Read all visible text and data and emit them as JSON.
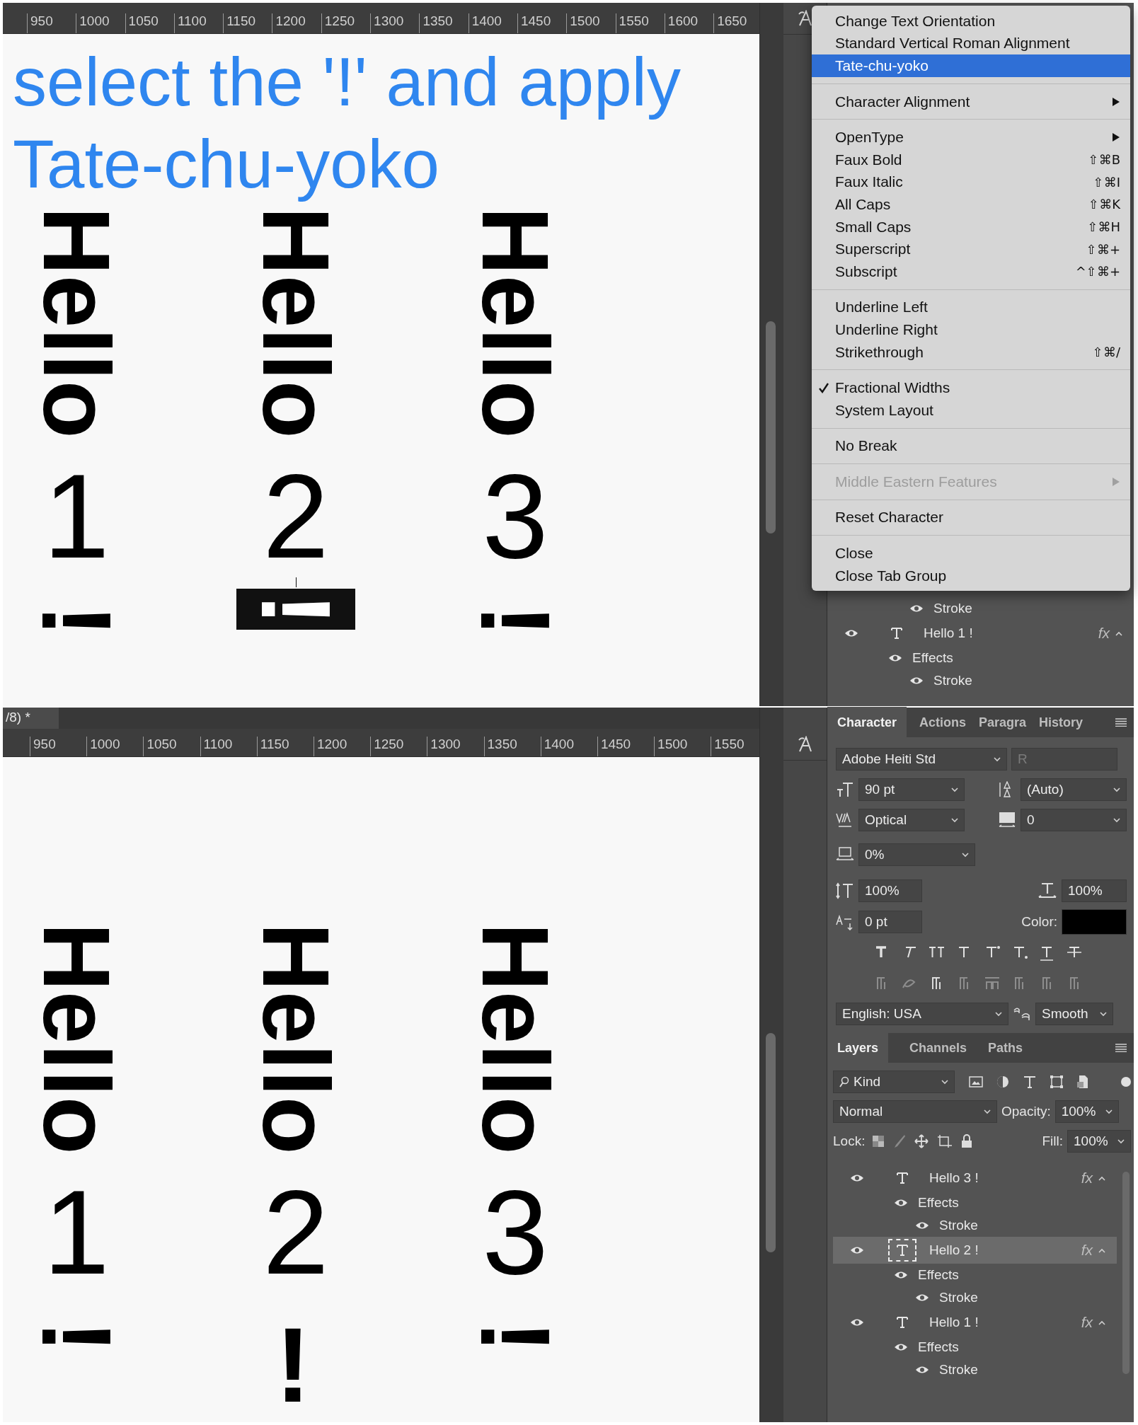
{
  "top_document": {
    "ruler_labels": [
      "950",
      "1000",
      "1050",
      "1100",
      "1150",
      "1200",
      "1250",
      "1300",
      "1350",
      "1400",
      "1450",
      "1500",
      "1550",
      "1600",
      "1650"
    ],
    "annotation": [
      "select the '!' and apply",
      "Tate-chu-yoko"
    ],
    "columns": [
      {
        "word": "Hello",
        "number": "1",
        "mark": "!",
        "mark_upright": false,
        "selected": false
      },
      {
        "word": "Hello",
        "number": "2",
        "mark": "!",
        "mark_upright": false,
        "selected": true
      },
      {
        "word": "Hello",
        "number": "3",
        "mark": "!",
        "mark_upright": false,
        "selected": false
      }
    ]
  },
  "top_panel": {
    "layers": [
      {
        "kind": "stroke",
        "name": "Stroke",
        "selected": false
      },
      {
        "kind": "layer",
        "name": "Hello 1 !",
        "fx": "fx",
        "selected": false,
        "children": [
          {
            "kind": "effects",
            "name": "Effects",
            "selected": false,
            "children": [
              {
                "kind": "stroke",
                "name": "Stroke",
                "selected": false
              }
            ]
          }
        ]
      }
    ]
  },
  "menu": {
    "groups": [
      [
        {
          "label": "Change Text Orientation",
          "submenu": false,
          "checked": false,
          "disabled": false,
          "selected": false
        },
        {
          "label": "Standard Vertical Roman Alignment",
          "submenu": false,
          "checked": false,
          "disabled": false,
          "selected": false
        },
        {
          "label": "Tate-chu-yoko",
          "submenu": false,
          "checked": false,
          "disabled": false,
          "selected": true
        }
      ],
      [
        {
          "label": "Character Alignment",
          "submenu": true,
          "checked": false,
          "disabled": false,
          "selected": false
        }
      ],
      [
        {
          "label": "OpenType",
          "submenu": true,
          "checked": false,
          "disabled": false,
          "selected": false
        },
        {
          "label": "Faux Bold",
          "shortcut": "⇧⌘B",
          "submenu": false,
          "checked": false,
          "disabled": false,
          "selected": false
        },
        {
          "label": "Faux Italic",
          "shortcut": "⇧⌘I",
          "submenu": false,
          "checked": false,
          "disabled": false,
          "selected": false
        },
        {
          "label": "All Caps",
          "shortcut": "⇧⌘K",
          "submenu": false,
          "checked": false,
          "disabled": false,
          "selected": false
        },
        {
          "label": "Small Caps",
          "shortcut": "⇧⌘H",
          "submenu": false,
          "checked": false,
          "disabled": false,
          "selected": false
        },
        {
          "label": "Superscript",
          "shortcut": "⇧⌘+",
          "submenu": false,
          "checked": false,
          "disabled": false,
          "selected": false
        },
        {
          "label": "Subscript",
          "shortcut": "^⇧⌘+",
          "submenu": false,
          "checked": false,
          "disabled": false,
          "selected": false
        }
      ],
      [
        {
          "label": "Underline Left",
          "submenu": false,
          "checked": false,
          "disabled": false,
          "selected": false
        },
        {
          "label": "Underline Right",
          "submenu": false,
          "checked": false,
          "disabled": false,
          "selected": false
        },
        {
          "label": "Strikethrough",
          "shortcut": "⇧⌘/",
          "submenu": false,
          "checked": false,
          "disabled": false,
          "selected": false
        }
      ],
      [
        {
          "label": "Fractional Widths",
          "submenu": false,
          "checked": true,
          "disabled": false,
          "selected": false
        },
        {
          "label": "System Layout",
          "submenu": false,
          "checked": false,
          "disabled": false,
          "selected": false
        }
      ],
      [
        {
          "label": "No Break",
          "submenu": false,
          "checked": false,
          "disabled": false,
          "selected": false
        }
      ],
      [
        {
          "label": "Middle Eastern Features",
          "submenu": true,
          "checked": false,
          "disabled": true,
          "selected": false
        }
      ],
      [
        {
          "label": "Reset Character",
          "submenu": false,
          "checked": false,
          "disabled": false,
          "selected": false
        }
      ],
      [
        {
          "label": "Close",
          "submenu": false,
          "checked": false,
          "disabled": false,
          "selected": false
        },
        {
          "label": "Close Tab Group",
          "submenu": false,
          "checked": false,
          "disabled": false,
          "selected": false
        }
      ]
    ]
  },
  "bottom_document": {
    "tab": "/8) *",
    "ruler_labels": [
      "950",
      "1000",
      "1050",
      "1100",
      "1150",
      "1200",
      "1250",
      "1300",
      "1350",
      "1400",
      "1450",
      "1500",
      "1550"
    ],
    "columns": [
      {
        "word": "Hello",
        "number": "1",
        "mark": "!",
        "mark_upright": false,
        "selected": false
      },
      {
        "word": "Hello",
        "number": "2",
        "mark": "!",
        "mark_upright": true,
        "selected": false
      },
      {
        "word": "Hello",
        "number": "3",
        "mark": "!",
        "mark_upright": false,
        "selected": false
      }
    ]
  },
  "character_panel": {
    "tabs": [
      {
        "label": "Character",
        "selected": true
      },
      {
        "label": "Actions",
        "selected": false
      },
      {
        "label": "Paragra",
        "selected": false
      },
      {
        "label": "History",
        "selected": false
      }
    ],
    "font_family": "Adobe Heiti Std",
    "font_style": {
      "value": "R",
      "disabled": true
    },
    "font_size": "90 pt",
    "leading": "(Auto)",
    "kerning": "Optical",
    "tracking": "0",
    "tsume": "0%",
    "vertical_scale": "100%",
    "horizontal_scale": "100%",
    "baseline_shift": "0 pt",
    "color_label": "Color:",
    "language": "English: USA",
    "antialiasing": "Smooth"
  },
  "layers_panel": {
    "tabs": [
      {
        "label": "Layers",
        "selected": true
      },
      {
        "label": "Channels",
        "selected": false
      },
      {
        "label": "Paths",
        "selected": false
      }
    ],
    "filter": "Kind",
    "blend_mode": "Normal",
    "opacity_label": "Opacity:",
    "opacity": "100%",
    "lock_label": "Lock:",
    "fill_label": "Fill:",
    "fill": "100%",
    "layers": [
      {
        "kind": "layer",
        "name": "Hello 3 !",
        "fx": "fx",
        "selected": false,
        "children": [
          {
            "kind": "effects",
            "name": "Effects",
            "selected": false,
            "children": [
              {
                "kind": "stroke",
                "name": "Stroke",
                "selected": false
              }
            ]
          }
        ]
      },
      {
        "kind": "layer",
        "name": "Hello 2 !",
        "fx": "fx",
        "selected": true,
        "children": [
          {
            "kind": "effects",
            "name": "Effects",
            "selected": false,
            "children": [
              {
                "kind": "stroke",
                "name": "Stroke",
                "selected": false
              }
            ]
          }
        ]
      },
      {
        "kind": "layer",
        "name": "Hello 1 !",
        "fx": "fx",
        "selected": false,
        "children": [
          {
            "kind": "effects",
            "name": "Effects",
            "selected": false,
            "children": [
              {
                "kind": "stroke",
                "name": "Stroke",
                "selected": false
              }
            ]
          }
        ]
      }
    ]
  }
}
